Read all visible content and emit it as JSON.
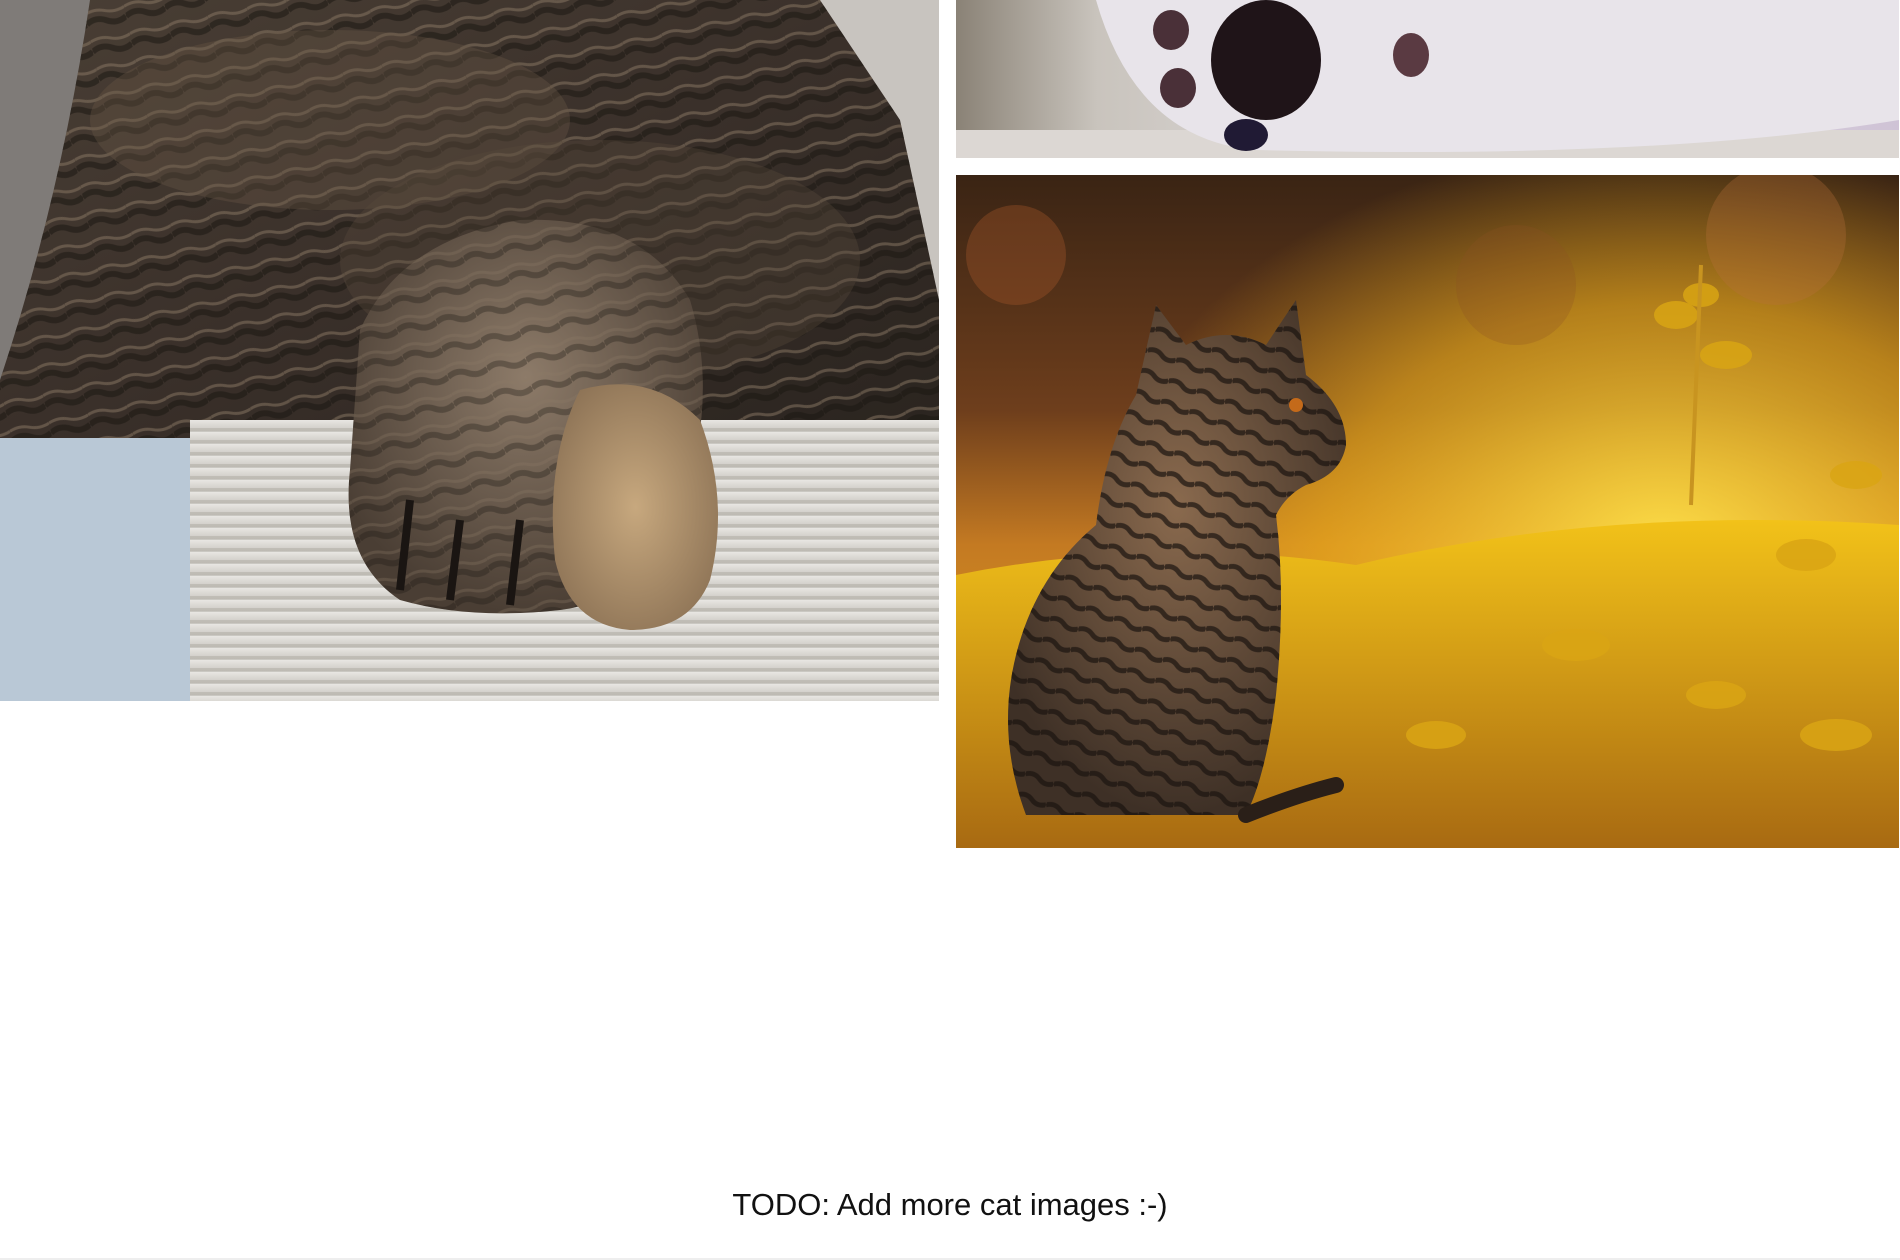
{
  "gallery": {
    "images": [
      {
        "subject": "cat-paws-on-scratcher"
      },
      {
        "subject": "white-cat-paw-pad"
      },
      {
        "subject": "tabby-kitten-in-sunny-grass"
      }
    ]
  },
  "footer": {
    "todo_text": "TODO: Add more cat images :-)"
  },
  "colors": {
    "background": "#ffffff",
    "bottom_bar": "#eeeeee",
    "text": "#111111"
  }
}
